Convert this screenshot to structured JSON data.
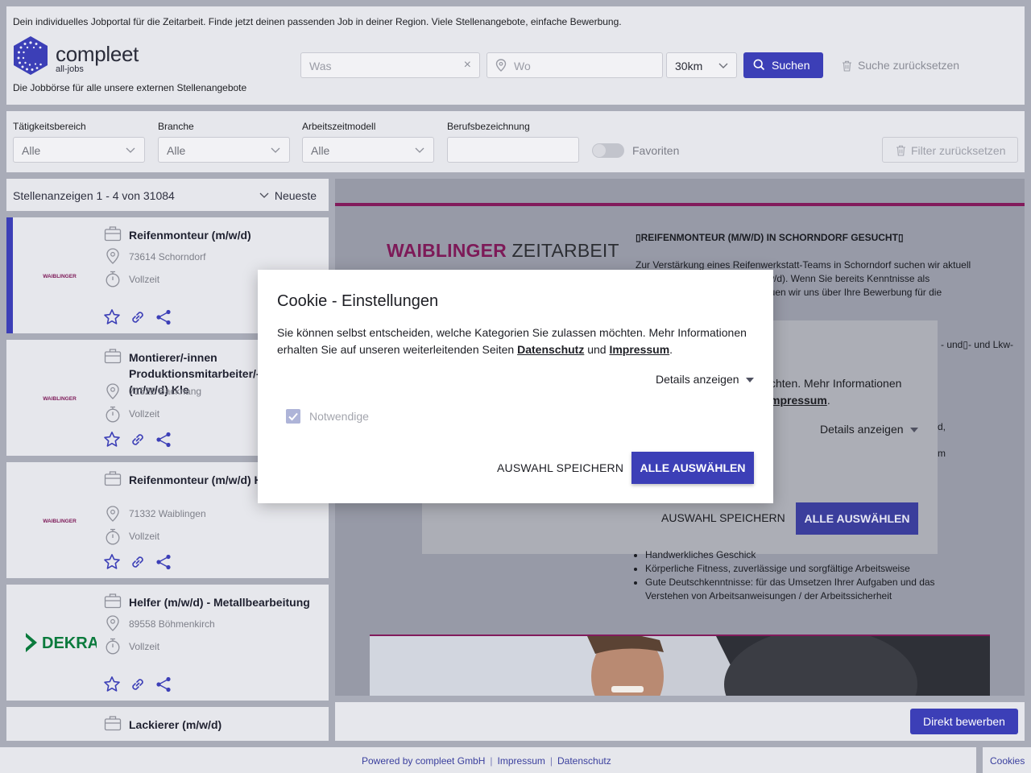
{
  "header": {
    "tagline": "Dein individuelles Jobportal für die Zeitarbeit. Finde jetzt deinen passenden Job in deiner Region. Viele Stellenangebote, einfache Bewerbung.",
    "brand": "compleet",
    "brand_sub": "all-jobs",
    "subtitle": "Die Jobbörse für alle unsere externen Stellenangebote",
    "search_was_placeholder": "Was",
    "search_wo_placeholder": "Wo",
    "radius": "30km",
    "search_button": "Suchen",
    "reset_search": "Suche zurücksetzen"
  },
  "filters": {
    "taetigkeit": {
      "label": "Tätigkeitsbereich",
      "value": "Alle"
    },
    "branche": {
      "label": "Branche",
      "value": "Alle"
    },
    "arbeitszeit": {
      "label": "Arbeitszeitmodell",
      "value": "Alle"
    },
    "beruf": {
      "label": "Berufsbezeichnung",
      "value": ""
    },
    "favorites_label": "Favoriten",
    "favorites_on": false,
    "reset_label": "Filter zurücksetzen"
  },
  "list": {
    "count_label": "Stellenanzeigen 1 - 4 von 31084",
    "sort_label": "Neueste",
    "jobs": [
      {
        "title": "Reifenmonteur (m/w/d)",
        "location": "73614 Schorndorf",
        "time": "Vollzeit",
        "company": "WAIBLINGER ZEITARBEIT"
      },
      {
        "title": "Montierer/-innen Produktionsmitarbeiter/-innen (m/w/d) Kle",
        "location": "71522 Backnang",
        "time": "Vollzeit",
        "company": "WAIBLINGER ZEITARBEIT"
      },
      {
        "title": "Reifenmonteur (m/w/d) Hn 2026",
        "location": "71332 Waiblingen",
        "time": "Vollzeit",
        "company": "WAIBLINGER ZEITARBEIT"
      },
      {
        "title": "Helfer (m/w/d) - Metallbearbeitung",
        "location": "89558 Böhmenkirch",
        "time": "Vollzeit",
        "company": "DEKRA"
      },
      {
        "title": "Lackierer (m/w/d)",
        "location": "",
        "time": "",
        "company": ""
      }
    ]
  },
  "detail": {
    "company_logo_a": "WAIBLINGER",
    "company_logo_b": "ZEITARBEIT",
    "ad_title": "REIFENMONTEUR (M/W/D) IN SCHORNDORF GESUCHT",
    "ad_intro": "Zur Verstärkung eines Reifenwerkstatt-Teams in Schorndorf suchen wir aktuell",
    "ad_intro_2": "/w/d). Wenn Sie bereits Kenntnisse als",
    "ad_intro_3": "euen wir uns über Ihre Bewerbung für die",
    "frag_kfz": "- und Lkw-",
    "frag_d": "d,",
    "frag_m": "m",
    "requirements": [
      "Handwerkliches Geschick",
      "Körperliche Fitness, zuverlässige und sorgfältige Arbeitsweise",
      "Gute Deutschkenntnisse:  für das Umsetzen Ihrer Aufgaben und das Verstehen von Arbeitsanweisungen / der Arbeitssicherheit"
    ],
    "apply_button": "Direkt bewerben"
  },
  "inner_dialog": {
    "frag_1": "chten. Mehr Informationen",
    "frag_2": "mpressum",
    "frag_2_tail": ".",
    "details": "Details anzeigen",
    "save": "AUSWAHL SPEICHERN",
    "all": "ALLE AUSWÄHLEN"
  },
  "cookie_modal": {
    "title": "Cookie - Einstellungen",
    "text_1": "Sie können selbst entscheiden, welche Kategorien Sie zulassen möchten. Mehr Informationen erhalten Sie auf unseren weiterleitenden Seiten ",
    "link_privacy": "Datenschutz",
    "text_and": " und ",
    "link_imprint": "Impressum",
    "text_end": ".",
    "details": "Details anzeigen",
    "category_necessary": "Notwendige",
    "save": "AUSWAHL SPEICHERN",
    "select_all": "ALLE AUSWÄHLEN"
  },
  "footer": {
    "powered": "Powered by compleet GmbH",
    "impressum": "Impressum",
    "datenschutz": "Datenschutz",
    "cookies": "Cookies"
  },
  "colors": {
    "accent": "#3c3fb7",
    "brand_magenta": "#821b5c",
    "dekra_green": "#0a7a3c"
  }
}
